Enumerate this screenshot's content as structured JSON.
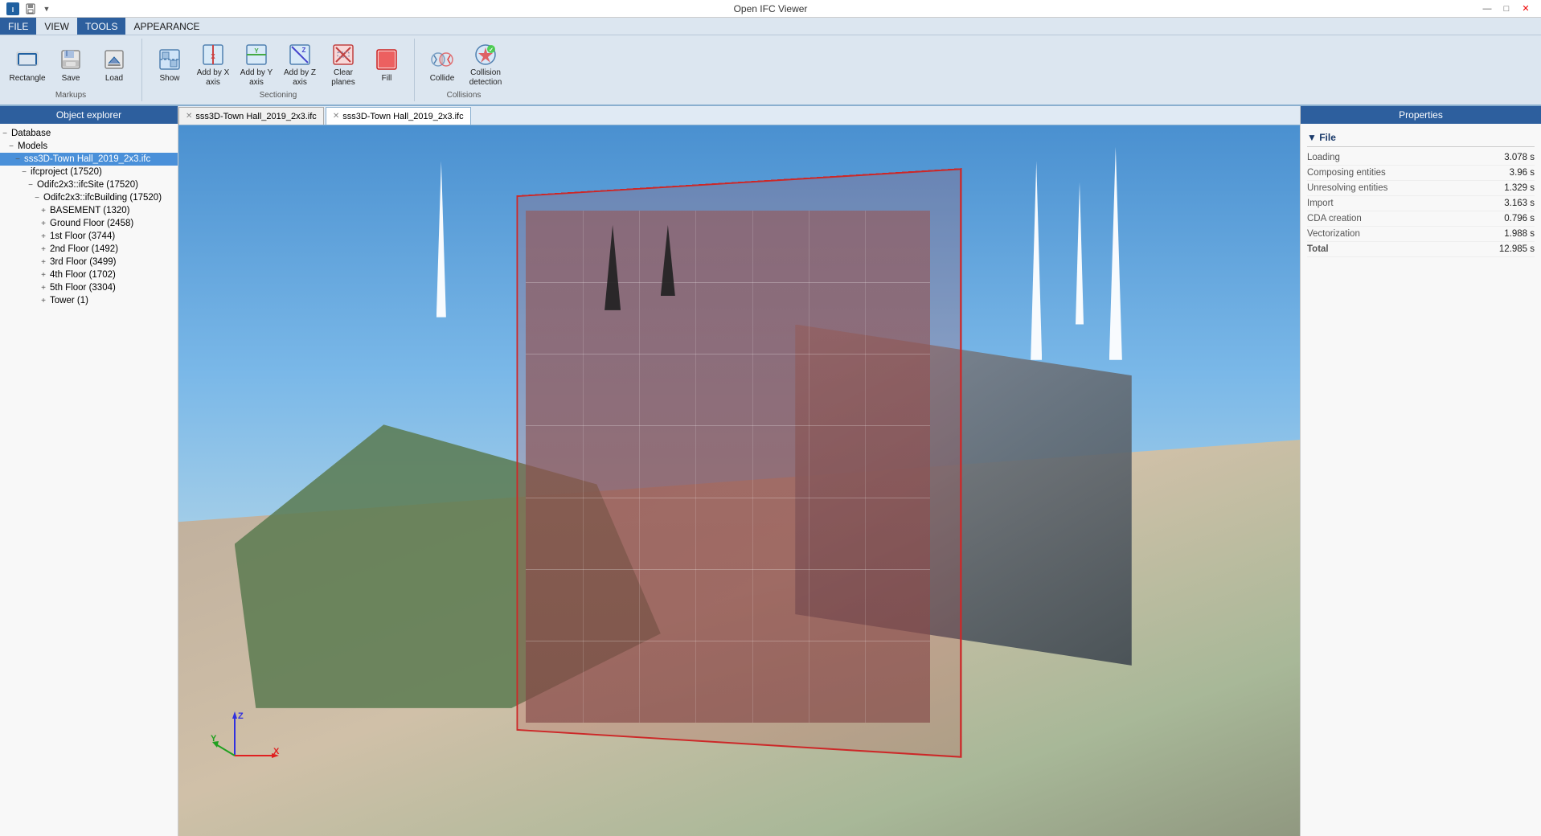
{
  "titlebar": {
    "title": "Open IFC Viewer",
    "app_icon": "IFC",
    "min_label": "—",
    "max_label": "□",
    "close_label": "✕"
  },
  "menubar": {
    "items": [
      {
        "id": "file",
        "label": "FILE",
        "active": true
      },
      {
        "id": "view",
        "label": "VIEW",
        "active": false
      },
      {
        "id": "tools",
        "label": "TOOLS",
        "active": true
      },
      {
        "id": "appearance",
        "label": "APPEARANCE",
        "active": false
      }
    ]
  },
  "toolbar": {
    "groups": [
      {
        "id": "markups",
        "label": "Markups",
        "items": [
          {
            "id": "rectangle",
            "label": "Rectangle"
          },
          {
            "id": "save",
            "label": "Save"
          },
          {
            "id": "load",
            "label": "Load"
          }
        ]
      },
      {
        "id": "sectioning",
        "label": "Sectioning",
        "items": [
          {
            "id": "show",
            "label": "Show"
          },
          {
            "id": "add-x",
            "label": "Add by X\naxis"
          },
          {
            "id": "add-y",
            "label": "Add by Y\naxis"
          },
          {
            "id": "add-z",
            "label": "Add by Z\naxis"
          },
          {
            "id": "clear-planes",
            "label": "Clear\nplanes"
          },
          {
            "id": "fill",
            "label": "Fill"
          }
        ]
      },
      {
        "id": "collisions",
        "label": "Collisions",
        "items": [
          {
            "id": "collide",
            "label": "Collide"
          },
          {
            "id": "collision-detection",
            "label": "Collision\ndetection"
          }
        ]
      }
    ]
  },
  "left_panel": {
    "header": "Object explorer",
    "tree": [
      {
        "id": "database",
        "label": "Database",
        "indent": 0,
        "expander": "−",
        "icon": "db"
      },
      {
        "id": "models",
        "label": "Models",
        "indent": 1,
        "expander": "−",
        "icon": "folder"
      },
      {
        "id": "file",
        "label": "sss3D-Town Hall_2019_2x3.ifc",
        "indent": 2,
        "expander": "−",
        "icon": "file",
        "selected": true
      },
      {
        "id": "ifcproject",
        "label": "ifcproject (17520)",
        "indent": 3,
        "expander": "−",
        "icon": ""
      },
      {
        "id": "ifcsite",
        "label": "Odifc2x3::ifcSite (17520)",
        "indent": 4,
        "expander": "−",
        "icon": ""
      },
      {
        "id": "ifcbuilding",
        "label": "Odifc2x3::ifcBuilding (17520)",
        "indent": 5,
        "expander": "−",
        "icon": ""
      },
      {
        "id": "basement",
        "label": "BASEMENT (1320)",
        "indent": 6,
        "expander": "+",
        "icon": ""
      },
      {
        "id": "ground",
        "label": "Ground Floor (2458)",
        "indent": 6,
        "expander": "+",
        "icon": ""
      },
      {
        "id": "floor1",
        "label": "1st Floor (3744)",
        "indent": 6,
        "expander": "+",
        "icon": ""
      },
      {
        "id": "floor2",
        "label": "2nd Floor (1492)",
        "indent": 6,
        "expander": "+",
        "icon": ""
      },
      {
        "id": "floor3",
        "label": "3rd  Floor (3499)",
        "indent": 6,
        "expander": "+",
        "icon": ""
      },
      {
        "id": "floor4",
        "label": "4th Floor (1702)",
        "indent": 6,
        "expander": "+",
        "icon": ""
      },
      {
        "id": "floor5",
        "label": "5th Floor (3304)",
        "indent": 6,
        "expander": "+",
        "icon": ""
      },
      {
        "id": "tower",
        "label": "Tower (1)",
        "indent": 6,
        "expander": "+",
        "icon": ""
      }
    ]
  },
  "tabs": [
    {
      "id": "tab1",
      "label": "sss3D-Town Hall_2019_2x3.ifc",
      "active": false,
      "closable": true
    },
    {
      "id": "tab2",
      "label": "sss3D-Town Hall_2019_2x3.ifc",
      "active": true,
      "closable": true
    }
  ],
  "right_panel": {
    "header": "Properties",
    "sections": [
      {
        "id": "file-section",
        "label": "File",
        "properties": [
          {
            "label": "Loading",
            "value": "3.078 s"
          },
          {
            "label": "Composing entities",
            "value": "3.96 s"
          },
          {
            "label": "Unresolving entities",
            "value": "1.329 s"
          },
          {
            "label": "Import",
            "value": "3.163 s"
          },
          {
            "label": "CDA creation",
            "value": "0.796 s"
          },
          {
            "label": "Vectorization",
            "value": "1.988 s"
          },
          {
            "label": "Total",
            "value": "12.985 s"
          }
        ]
      }
    ]
  },
  "axes": {
    "x_label": "X",
    "y_label": "Y",
    "z_label": "Z"
  }
}
